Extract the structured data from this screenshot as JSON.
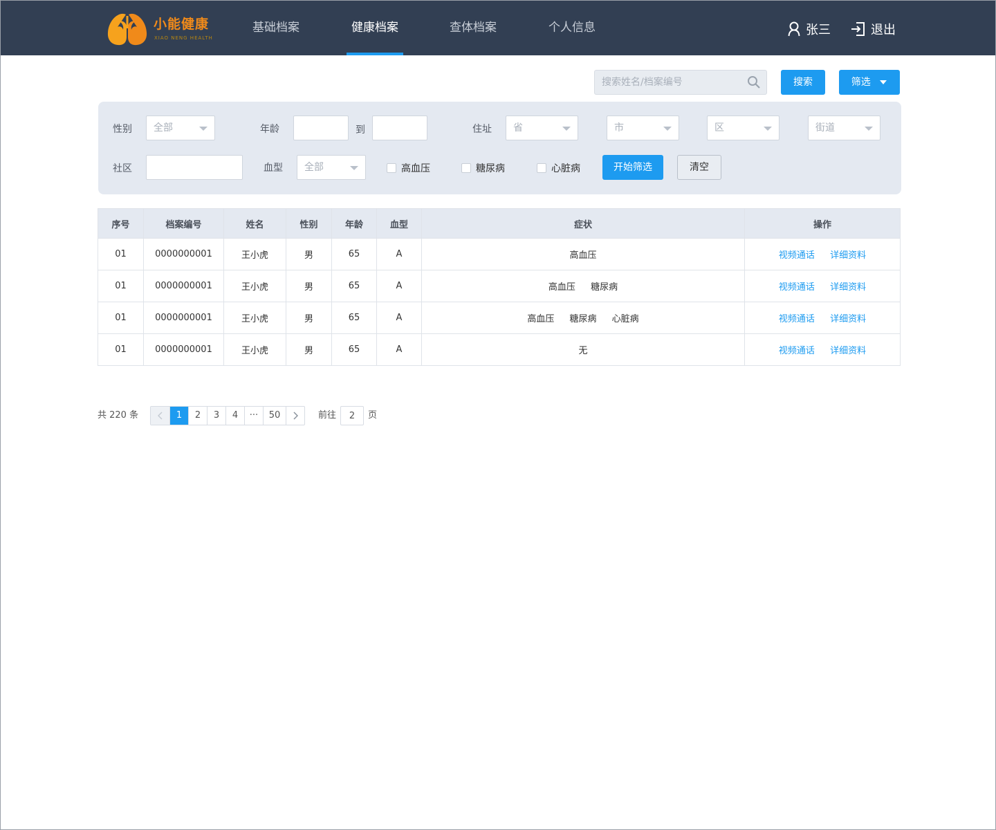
{
  "header": {
    "logo_title": "小能健康",
    "logo_subtitle": "XIAO NENG HEALTH",
    "nav": [
      {
        "label": "基础档案",
        "active": false
      },
      {
        "label": "健康档案",
        "active": true
      },
      {
        "label": "查体档案",
        "active": false
      },
      {
        "label": "个人信息",
        "active": false
      }
    ],
    "user_name": "张三",
    "logout_label": "退出"
  },
  "toolbar": {
    "search_placeholder": "搜索姓名/档案编号",
    "search_button": "搜索",
    "filter_button": "筛选"
  },
  "filters": {
    "gender_label": "性别",
    "gender_value": "全部",
    "age_label": "年龄",
    "age_to": "到",
    "address_label": "住址",
    "province": "省",
    "city": "市",
    "district": "区",
    "street": "街道",
    "community_label": "社区",
    "blood_label": "血型",
    "blood_value": "全部",
    "conditions": [
      "高血压",
      "糖尿病",
      "心脏病"
    ],
    "start_button": "开始筛选",
    "clear_button": "清空"
  },
  "table": {
    "headers": [
      "序号",
      "档案编号",
      "姓名",
      "性别",
      "年龄",
      "血型",
      "症状",
      "操作"
    ],
    "rows": [
      {
        "no": "01",
        "id": "0000000001",
        "name": "王小虎",
        "gender": "男",
        "age": "65",
        "blood": "A",
        "symptoms": [
          "高血压"
        ]
      },
      {
        "no": "01",
        "id": "0000000001",
        "name": "王小虎",
        "gender": "男",
        "age": "65",
        "blood": "A",
        "symptoms": [
          "高血压",
          "糖尿病"
        ]
      },
      {
        "no": "01",
        "id": "0000000001",
        "name": "王小虎",
        "gender": "男",
        "age": "65",
        "blood": "A",
        "symptoms": [
          "高血压",
          "糖尿病",
          "心脏病"
        ]
      },
      {
        "no": "01",
        "id": "0000000001",
        "name": "王小虎",
        "gender": "男",
        "age": "65",
        "blood": "A",
        "symptoms": [
          "无"
        ]
      }
    ],
    "actions": [
      "视频通话",
      "详细资料"
    ]
  },
  "pagination": {
    "total_text": "共 220 条",
    "pages": [
      "1",
      "2",
      "3",
      "4",
      "···",
      "50"
    ],
    "current": "1",
    "goto_label": "前往",
    "goto_value": "2",
    "page_unit": "页"
  },
  "colors": {
    "header_bg": "#323f53",
    "accent": "#1d9bf0",
    "panel_bg": "#e4e9f1",
    "logo_orange": "#f08a1a"
  }
}
